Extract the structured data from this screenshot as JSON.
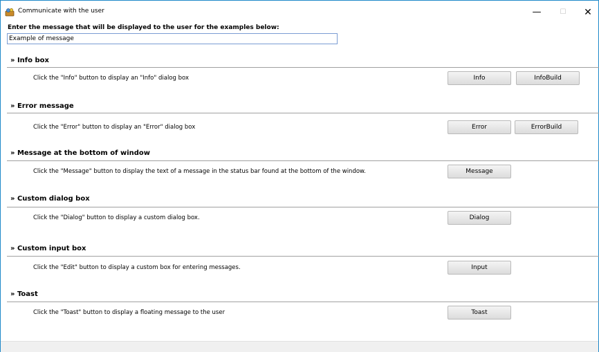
{
  "window": {
    "title": "Communicate with the user",
    "minimize_glyph": "—",
    "maximize_glyph": "☐",
    "close_glyph": "✕"
  },
  "prompt": {
    "label": "Enter the message that will be displayed to the user for the examples below:",
    "value": "Example of message"
  },
  "sections": [
    {
      "title": "» Info box",
      "description": "Click the \"Info\" button to display an \"Info\" dialog box",
      "buttons": [
        "Info",
        "InfoBuild"
      ]
    },
    {
      "title": "» Error message",
      "description": "Click the \"Error\" button to display an \"Error\" dialog box",
      "buttons": [
        "Error",
        "ErrorBuild"
      ]
    },
    {
      "title": "» Message at the bottom of window",
      "description": "Click the \"Message\" button to display the text of a message in the status bar found at the bottom of the window.",
      "buttons": [
        "Message"
      ]
    },
    {
      "title": "» Custom dialog box",
      "description": "Click the \"Dialog\" button to display a custom dialog box.",
      "buttons": [
        "Dialog"
      ]
    },
    {
      "title": "» Custom input box",
      "description": "Click the \"Edit\" button to display a custom box for entering messages.",
      "buttons": [
        "Input"
      ]
    },
    {
      "title": "» Toast",
      "description": "Click the \"Toast\" button to display a floating message to the user",
      "buttons": [
        "Toast"
      ]
    }
  ]
}
